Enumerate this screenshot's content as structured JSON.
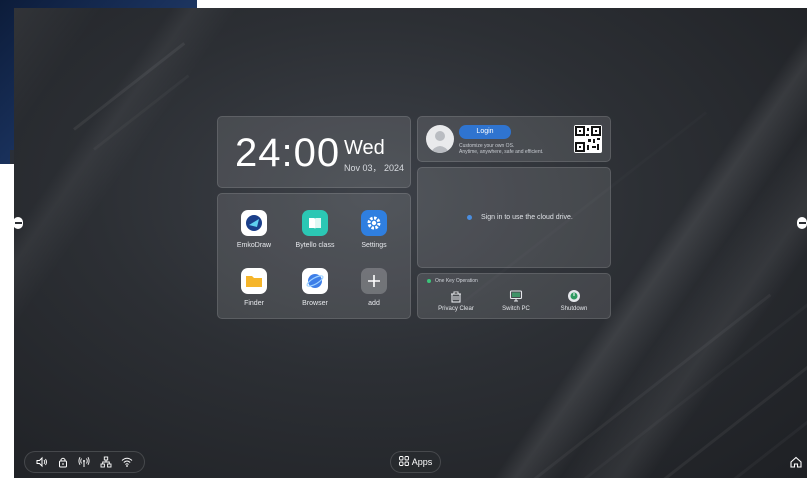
{
  "clock": {
    "time": "24:00",
    "day": "Wed",
    "date": "Nov 03， 2024"
  },
  "apps": [
    {
      "label": "EmkoDraw",
      "icon": "emkodraw-icon",
      "color": "#ffffff"
    },
    {
      "label": "Bytello class",
      "icon": "book-icon",
      "color": "#2bc7b4"
    },
    {
      "label": "Settings",
      "icon": "gear-icon",
      "color": "#2f7fe0"
    },
    {
      "label": "Finder",
      "icon": "folder-icon",
      "color": "#f5b52a"
    },
    {
      "label": "Browser",
      "icon": "globe-icon",
      "color": "#3e7ee8"
    },
    {
      "label": "add",
      "icon": "plus-icon",
      "color": "#8a8e95"
    }
  ],
  "login": {
    "button_label": "Login",
    "tagline_1": "Customize your own OS.",
    "tagline_2": "Anytime, anywhere, safe and efficient."
  },
  "cloud": {
    "message": "Sign in to use the cloud drive."
  },
  "one_key": {
    "title": "One Key Operation",
    "items": [
      {
        "label": "Privacy Clear",
        "icon": "broom-icon"
      },
      {
        "label": "Switch PC",
        "icon": "monitor-icon"
      },
      {
        "label": "Shutdown",
        "icon": "power-icon"
      }
    ]
  },
  "taskbar": {
    "tray_icons": [
      "speaker-icon",
      "lock-icon",
      "antenna-icon",
      "network-icon",
      "wifi-icon"
    ],
    "apps_label": "Apps"
  },
  "colors": {
    "accent": "#2f74d0",
    "status_green": "#3cc47a"
  }
}
